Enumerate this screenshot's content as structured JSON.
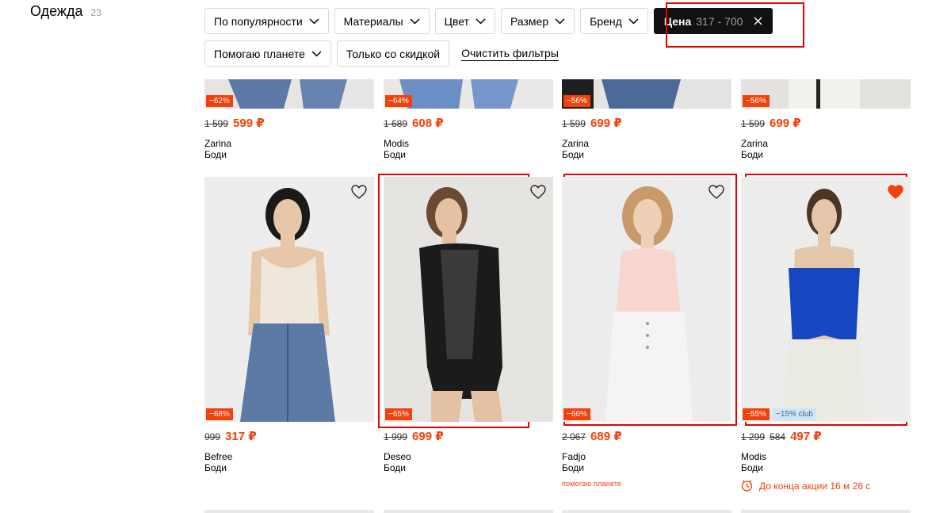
{
  "category": {
    "name": "Одежда",
    "count": "23"
  },
  "filters": {
    "row1": [
      {
        "label": "По популярности"
      },
      {
        "label": "Материалы"
      },
      {
        "label": "Цвет"
      },
      {
        "label": "Размер"
      },
      {
        "label": "Бренд"
      }
    ],
    "price": {
      "label": "Цена",
      "range": "317 - 700"
    },
    "row2": [
      {
        "label": "Помогаю планете"
      },
      {
        "label": "Только со скидкой"
      }
    ],
    "clear": "Очистить фильтры"
  },
  "top_products": [
    {
      "badge": "−62%",
      "old_price": "1 599",
      "price": "599 ₽",
      "brand": "Zarina",
      "type": "Боди"
    },
    {
      "badge": "−64%",
      "old_price": "1 689",
      "price": "608 ₽",
      "brand": "Modis",
      "type": "Боди"
    },
    {
      "badge": "−56%",
      "old_price": "1 599",
      "price": "699 ₽",
      "brand": "Zarina",
      "type": "Боди"
    },
    {
      "badge": "−56%",
      "old_price": "1 599",
      "price": "699 ₽",
      "brand": "Zarina",
      "type": "Боди"
    }
  ],
  "products": [
    {
      "badge": "−68%",
      "old_price": "999",
      "price": "317 ₽",
      "brand": "Befree",
      "type": "Боди",
      "favorite": false
    },
    {
      "badge": "−65%",
      "old_price": "1 999",
      "price": "699 ₽",
      "brand": "Deseo",
      "type": "Боди",
      "favorite": false
    },
    {
      "badge": "−66%",
      "old_price": "2 067",
      "price": "689 ₽",
      "brand": "Fadjo",
      "type": "Боди",
      "favorite": false,
      "eco": "помогаю планете"
    },
    {
      "badge": "−55%",
      "club": "−15% club",
      "old_price": "1 299",
      "mid_price": "584",
      "price": "497 ₽",
      "brand": "Modis",
      "type": "Боди",
      "favorite": true,
      "timer": "До конца акции 16 м 26 с"
    }
  ],
  "colors": {
    "accent": "#f4410b",
    "highlight": "#e60000",
    "chip_active": "#111111",
    "club_bg": "#cfe4f7"
  },
  "icons": [
    "chevron-down-icon",
    "close-icon",
    "heart-icon",
    "clock-icon"
  ]
}
